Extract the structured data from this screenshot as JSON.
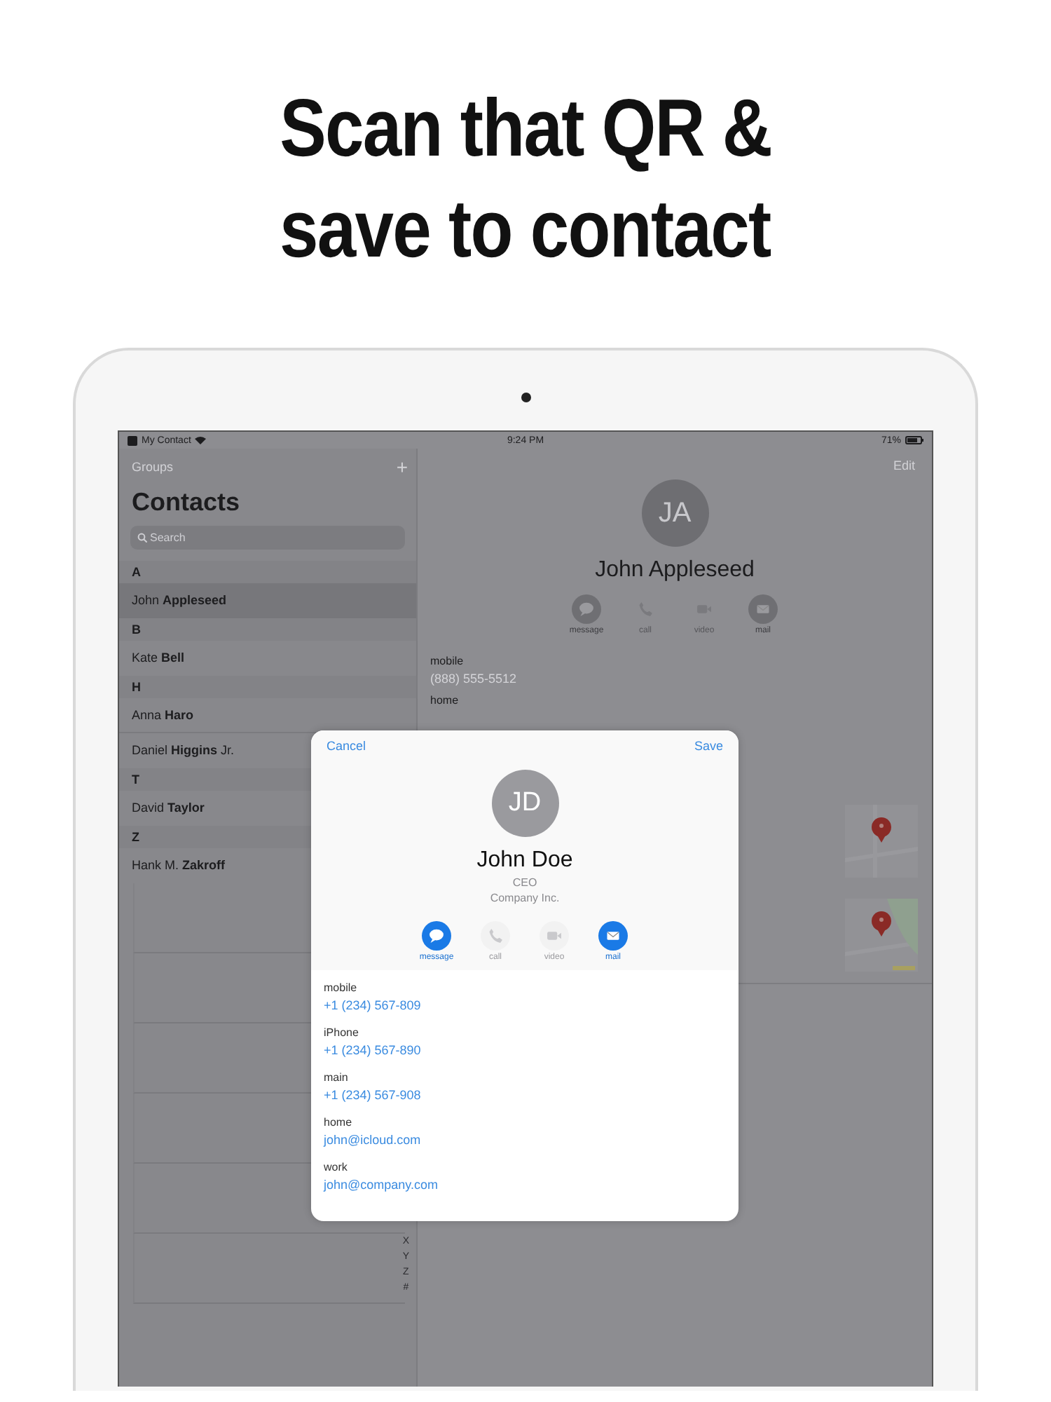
{
  "headline": {
    "lines": [
      "Scan that QR &",
      "save to contact"
    ]
  },
  "status_bar": {
    "app": "My Contact",
    "time": "9:24 PM",
    "battery": "71%"
  },
  "sidebar": {
    "groups_link": "Groups",
    "add_button": "+",
    "title": "Contacts",
    "search": {
      "placeholder": "Search"
    },
    "sections": [
      {
        "letter": "A",
        "contacts": [
          {
            "name": "John **Appleseed**",
            "selected": true
          }
        ]
      },
      {
        "letter": "B",
        "contacts": [
          {
            "name": "Kate **Bell**",
            "selected": false
          }
        ]
      },
      {
        "letter": "H",
        "contacts": [
          {
            "name": "Anna **Haro**",
            "selected": false
          },
          {
            "name": "Daniel **Higgins** Jr.",
            "selected": false
          }
        ]
      },
      {
        "letter": "T",
        "contacts": [
          {
            "name": "David **Taylor**",
            "selected": false
          }
        ]
      },
      {
        "letter": "Z",
        "contacts": [
          {
            "name": "Hank M. **Zakroff**",
            "selected": false
          }
        ]
      }
    ],
    "index_letters": [
      "X",
      "Y",
      "Z",
      "#"
    ]
  },
  "detail": {
    "edit_button": "Edit",
    "initials": "JA",
    "name": "John Appleseed",
    "actions": [
      {
        "kind": "message",
        "label": "message",
        "enabled": true
      },
      {
        "kind": "call",
        "label": "call",
        "enabled": false
      },
      {
        "kind": "video",
        "label": "video",
        "enabled": false
      },
      {
        "kind": "mail",
        "label": "mail",
        "enabled": true
      }
    ],
    "fields": [
      {
        "label": "mobile",
        "value": "(888) 555-5512"
      },
      {
        "label": "home"
      }
    ]
  },
  "sheet": {
    "cancel": "Cancel",
    "save": "Save",
    "initials": "JD",
    "name": "John Doe",
    "job_title": "CEO",
    "company": "Company Inc.",
    "actions": [
      {
        "kind": "message",
        "label": "message",
        "enabled": true
      },
      {
        "kind": "call",
        "label": "call",
        "enabled": false
      },
      {
        "kind": "video",
        "label": "video",
        "enabled": false
      },
      {
        "kind": "mail",
        "label": "mail",
        "enabled": true
      }
    ],
    "fields": [
      {
        "label": "mobile",
        "value": "+1 (234) 567-809"
      },
      {
        "label": "iPhone",
        "value": "+1 (234) 567-890"
      },
      {
        "label": "main",
        "value": "+1 (234) 567-908"
      },
      {
        "label": "home",
        "value": "john@icloud.com"
      },
      {
        "label": "work",
        "value": "john@company.com"
      }
    ]
  }
}
